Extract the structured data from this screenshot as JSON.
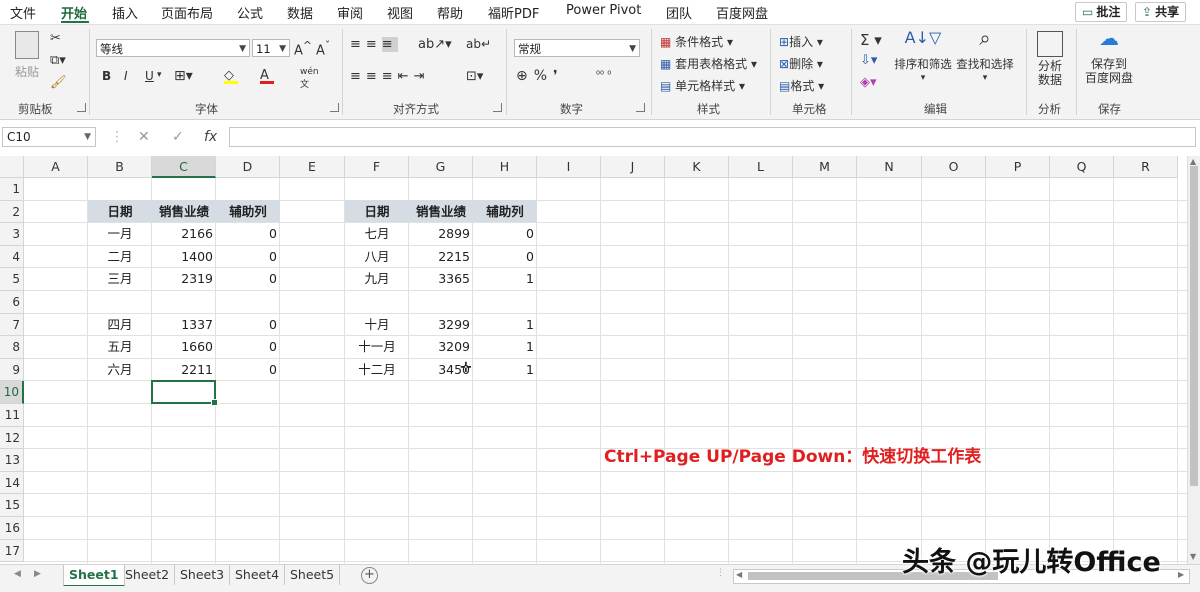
{
  "menu": {
    "tabs": [
      "文件",
      "开始",
      "插入",
      "页面布局",
      "公式",
      "数据",
      "审阅",
      "视图",
      "帮助",
      "福昕PDF",
      "Power Pivot",
      "团队",
      "百度网盘"
    ],
    "active": "开始",
    "comment_button": "批注",
    "share_button": "共享"
  },
  "ribbon": {
    "clipboard": {
      "label": "剪贴板",
      "paste": "粘贴"
    },
    "font": {
      "label": "字体",
      "font_name": "等线",
      "font_size": "11",
      "bold": "B",
      "italic": "I",
      "underline": "U"
    },
    "alignment": {
      "label": "对齐方式"
    },
    "number": {
      "label": "数字",
      "format": "常规"
    },
    "styles": {
      "label": "样式",
      "conditional": "条件格式",
      "table": "套用表格格式",
      "cell_styles": "单元格样式"
    },
    "cells": {
      "label": "单元格",
      "insert": "插入",
      "delete": "删除",
      "format": "格式"
    },
    "editing": {
      "label": "编辑",
      "sort_filter": "排序和筛选",
      "find_select": "查找和选择"
    },
    "analysis": {
      "label": "分析",
      "analyze": "分析\n数据"
    },
    "save": {
      "label": "保存",
      "save_baidu": "保存到\n百度网盘"
    }
  },
  "formula_bar": {
    "name_box": "C10",
    "formula": ""
  },
  "columns": [
    "A",
    "B",
    "C",
    "D",
    "E",
    "F",
    "G",
    "H",
    "I",
    "J",
    "K",
    "L",
    "M",
    "N",
    "O",
    "P",
    "Q",
    "R"
  ],
  "rows": [
    "1",
    "2",
    "3",
    "4",
    "5",
    "6",
    "7",
    "8",
    "9",
    "10",
    "11",
    "12",
    "13",
    "14",
    "15",
    "16",
    "17"
  ],
  "selected_cell": "C10",
  "table_left": {
    "headers": [
      "日期",
      "销售业绩",
      "辅助列"
    ],
    "rows": [
      [
        "一月",
        "2166",
        "0"
      ],
      [
        "二月",
        "1400",
        "0"
      ],
      [
        "三月",
        "2319",
        "0"
      ],
      [
        "",
        "",
        ""
      ],
      [
        "四月",
        "1337",
        "0"
      ],
      [
        "五月",
        "1660",
        "0"
      ],
      [
        "六月",
        "2211",
        "0"
      ]
    ]
  },
  "table_right": {
    "headers": [
      "日期",
      "销售业绩",
      "辅助列"
    ],
    "rows": [
      [
        "七月",
        "2899",
        "0"
      ],
      [
        "八月",
        "2215",
        "0"
      ],
      [
        "九月",
        "3365",
        "1"
      ],
      [
        "",
        "",
        ""
      ],
      [
        "十月",
        "3299",
        "1"
      ],
      [
        "十一月",
        "3209",
        "1"
      ],
      [
        "十二月",
        "3450",
        "1"
      ]
    ]
  },
  "annotation": "Ctrl+Page UP/Page Down：快速切换工作表",
  "sheets": [
    "Sheet1",
    "Sheet2",
    "Sheet3",
    "Sheet4",
    "Sheet5"
  ],
  "active_sheet": "Sheet1",
  "watermark": "头条 @玩儿转Office"
}
